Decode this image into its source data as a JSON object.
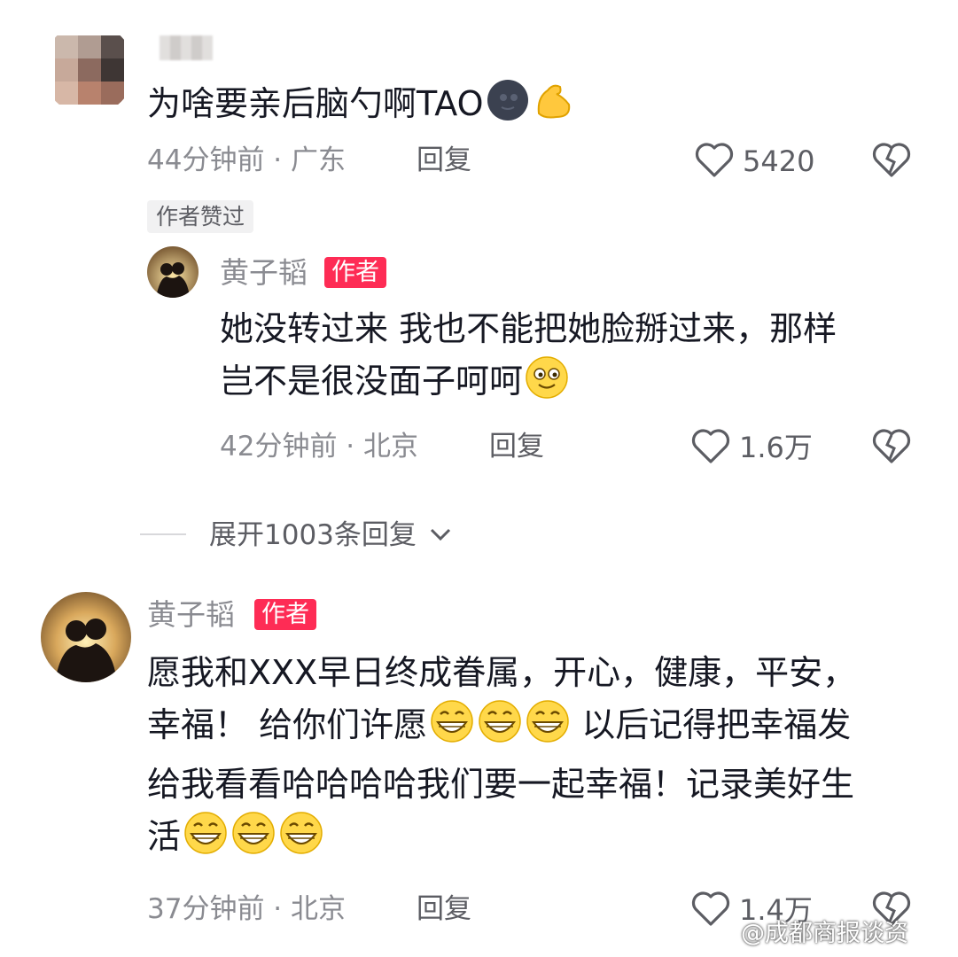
{
  "comment1": {
    "text": "为啥要亲后脑勺啊TAO",
    "time_location": "44分钟前 · 广东",
    "reply_label": "回复",
    "likes": "5420",
    "author_liked_badge": "作者赞过"
  },
  "reply1": {
    "username": "黄子韬",
    "author_tag": "作者",
    "text_line1": "她没转过来 我也不能把她脸掰过来，那样",
    "text_line2": "岂不是很没面子呵呵",
    "time_location": "42分钟前 · 北京",
    "reply_label": "回复",
    "likes": "1.6万"
  },
  "expand": {
    "label": "展开1003条回复"
  },
  "comment2": {
    "username": "黄子韬",
    "author_tag": "作者",
    "text_line1": "愿我和XXX早日终成眷属，开心，健康，平安，",
    "text_line2a": "幸福！ 给你们许愿",
    "text_line2b": "以后记得把幸福发",
    "text_line3": "给我看看哈哈哈哈我们要一起幸福！记录美好生",
    "text_line4": "活",
    "time_location": "37分钟前 · 北京",
    "reply_label": "回复",
    "likes": "1.4万"
  },
  "watermark": "@成都商报谈资",
  "icons": {
    "like": "heart-outline-icon",
    "dislike": "broken-heart-icon",
    "expand": "chevron-down-icon",
    "emoji_moon": "new-moon-face-emoji",
    "emoji_muscle": "flexed-biceps-emoji",
    "emoji_blush": "smiling-face-emoji",
    "emoji_grin": "grinning-face-emoji"
  },
  "colors": {
    "author_tag": "#fe2c55",
    "text": "#161823",
    "meta": "#8a8b91"
  }
}
